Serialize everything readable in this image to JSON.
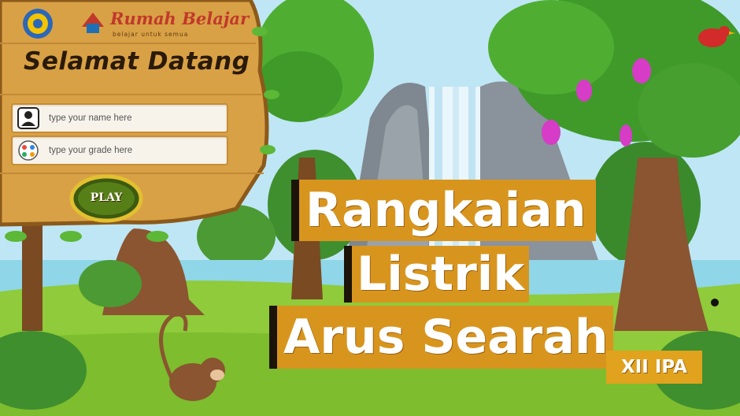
{
  "brand": {
    "name": "Rumah Belajar",
    "tagline": "belajar untuk semua"
  },
  "login": {
    "welcome": "Selamat Datang",
    "name_placeholder": "type your name here",
    "grade_placeholder": "type your grade here",
    "play_label": "PLAY"
  },
  "title": {
    "line1": "Rangkaian",
    "line2": "Listrik",
    "line3": "Arus Searah",
    "grade": "XII IPA"
  },
  "colors": {
    "title_bg": "#d8951e",
    "wood": "#d9a145",
    "sky": "#bfe6f5",
    "grass": "#8fcb3a"
  }
}
